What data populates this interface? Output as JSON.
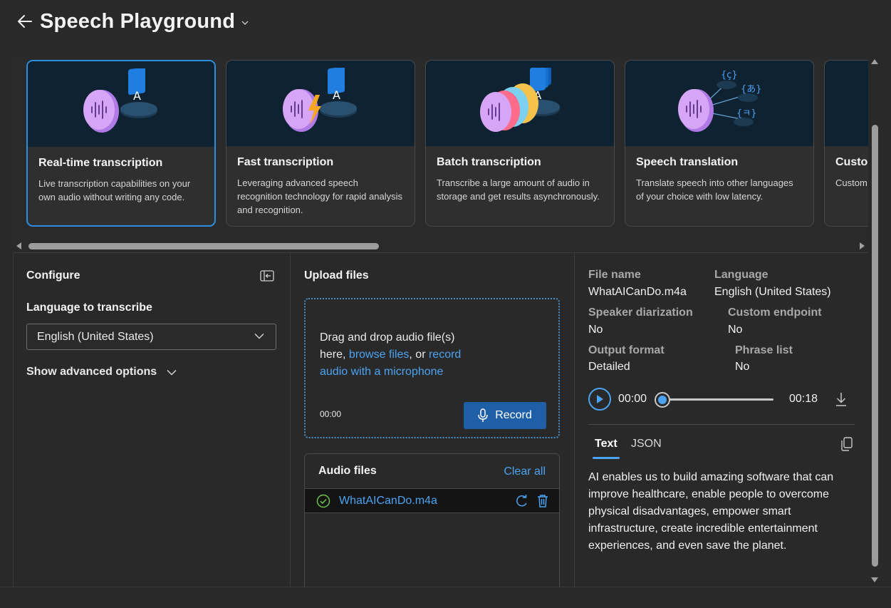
{
  "header": {
    "title": "Speech Playground"
  },
  "cards": [
    {
      "title": "Real-time transcription",
      "desc": "Live transcription capabilities on your own audio without writing any code.",
      "selected": true,
      "art": "mic-to-text"
    },
    {
      "title": "Fast transcription",
      "desc": "Leveraging advanced speech recognition technology for rapid analysis and recognition.",
      "selected": false,
      "art": "mic-lightning-to-text"
    },
    {
      "title": "Batch transcription",
      "desc": "Transcribe a large amount of audio in storage and get results asynchronously.",
      "selected": false,
      "art": "stacked-mics-to-text"
    },
    {
      "title": "Speech translation",
      "desc": "Translate speech into other languages of your choice with low latency.",
      "selected": false,
      "art": "mic-to-languages"
    },
    {
      "title": "Custom",
      "desc": "Custom data to styles, w",
      "selected": false,
      "art": "custom"
    }
  ],
  "configure": {
    "title": "Configure",
    "language_label": "Language to transcribe",
    "language_value": "English (United States)",
    "advanced_label": "Show advanced options"
  },
  "upload": {
    "title": "Upload files",
    "drop_text_1": "Drag and drop audio file(s) here, ",
    "browse_link": "browse files",
    "drop_text_2": ", or ",
    "record_link": "record audio with a microphone",
    "timer": "00:00",
    "record_label": "Record",
    "audio_files_title": "Audio files",
    "clear_all": "Clear all",
    "files": [
      {
        "name": "WhatAICanDo.m4a",
        "status": "done"
      }
    ]
  },
  "results": {
    "file_name_label": "File name",
    "file_name_value": "WhatAICanDo.m4a",
    "language_label": "Language",
    "language_value": "English (United States)",
    "diarization_label": "Speaker diarization",
    "diarization_value": "No",
    "endpoint_label": "Custom endpoint",
    "endpoint_value": "No",
    "format_label": "Output format",
    "format_value": "Detailed",
    "phrase_label": "Phrase list",
    "phrase_value": "No",
    "time_current": "00:00",
    "time_total": "00:18",
    "tab_text": "Text",
    "tab_json": "JSON",
    "transcript": "AI enables us to build amazing software that can improve healthcare, enable people to overcome physical disadvantages, empower smart infrastructure, create incredible entertainment experiences, and even save the planet."
  },
  "colors": {
    "background": "#292929",
    "accent": "#4ba3f2",
    "primary_button": "#1e5fa8",
    "selected_border": "#2d8ee0",
    "card_art_bg": "#0e2231"
  }
}
